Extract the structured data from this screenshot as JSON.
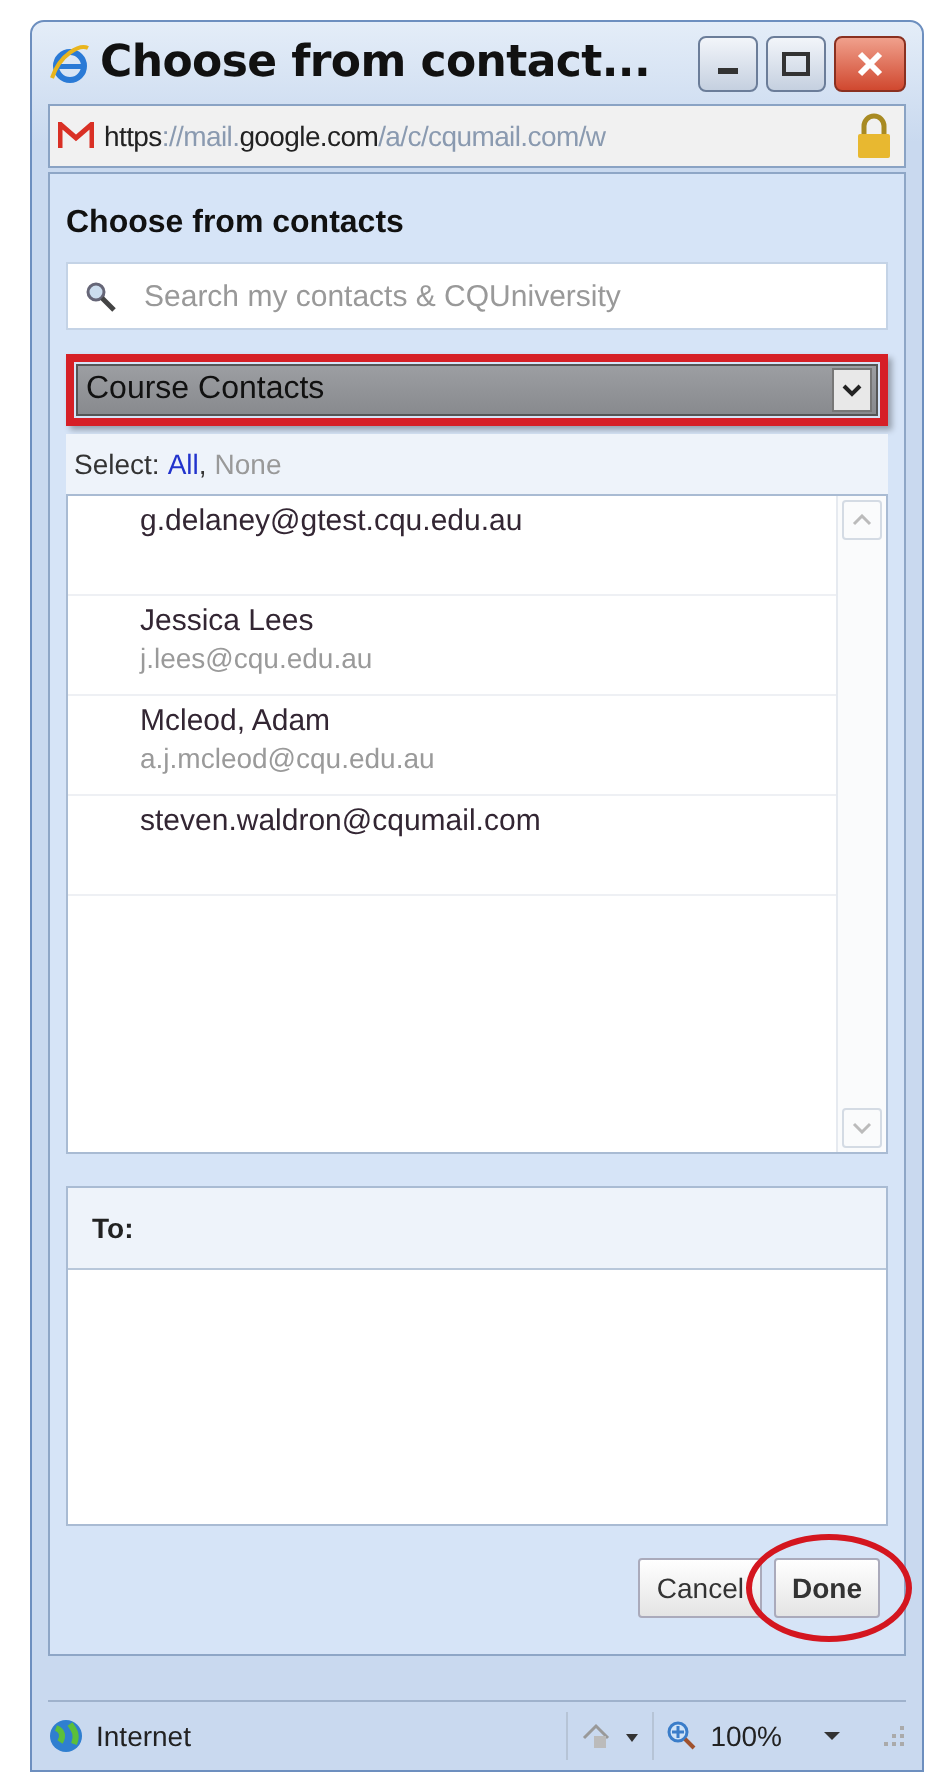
{
  "window": {
    "title": "Choose from contact...",
    "controls": [
      {
        "kind": "minimize"
      },
      {
        "kind": "maximize"
      },
      {
        "kind": "close"
      }
    ]
  },
  "address_bar": {
    "url_parts": [
      {
        "text": "https",
        "dim": false
      },
      {
        "text": "://mail.",
        "dim": true
      },
      {
        "text": "google.com",
        "dim": false
      },
      {
        "text": "/a/c/cqumail.com/w",
        "dim": true
      }
    ]
  },
  "dialog": {
    "heading": "Choose from contacts",
    "search": {
      "placeholder": "Search my contacts & CQUniversity"
    },
    "group_select": {
      "value": "Course Contacts",
      "highlighted": true
    },
    "select_label": "Select:",
    "select_links": [
      {
        "label": "All",
        "disabled": false
      },
      {
        "label": "None",
        "disabled": true
      }
    ],
    "select_separator": ",",
    "contacts": [
      {
        "name": "g.delaney@gtest.cqu.edu.au"
      },
      {
        "name": "Jessica Lees",
        "email": "j.lees@cqu.edu.au"
      },
      {
        "name": "Mcleod, Adam",
        "email": "a.j.mcleod@cqu.edu.au"
      },
      {
        "name": "steven.waldron@cqumail.com"
      }
    ],
    "to_label": "To:",
    "buttons": [
      {
        "label": "Cancel",
        "highlighted": false
      },
      {
        "label": "Done",
        "highlighted": true
      }
    ]
  },
  "status_bar": {
    "zone": "Internet",
    "zoom": "100%"
  }
}
